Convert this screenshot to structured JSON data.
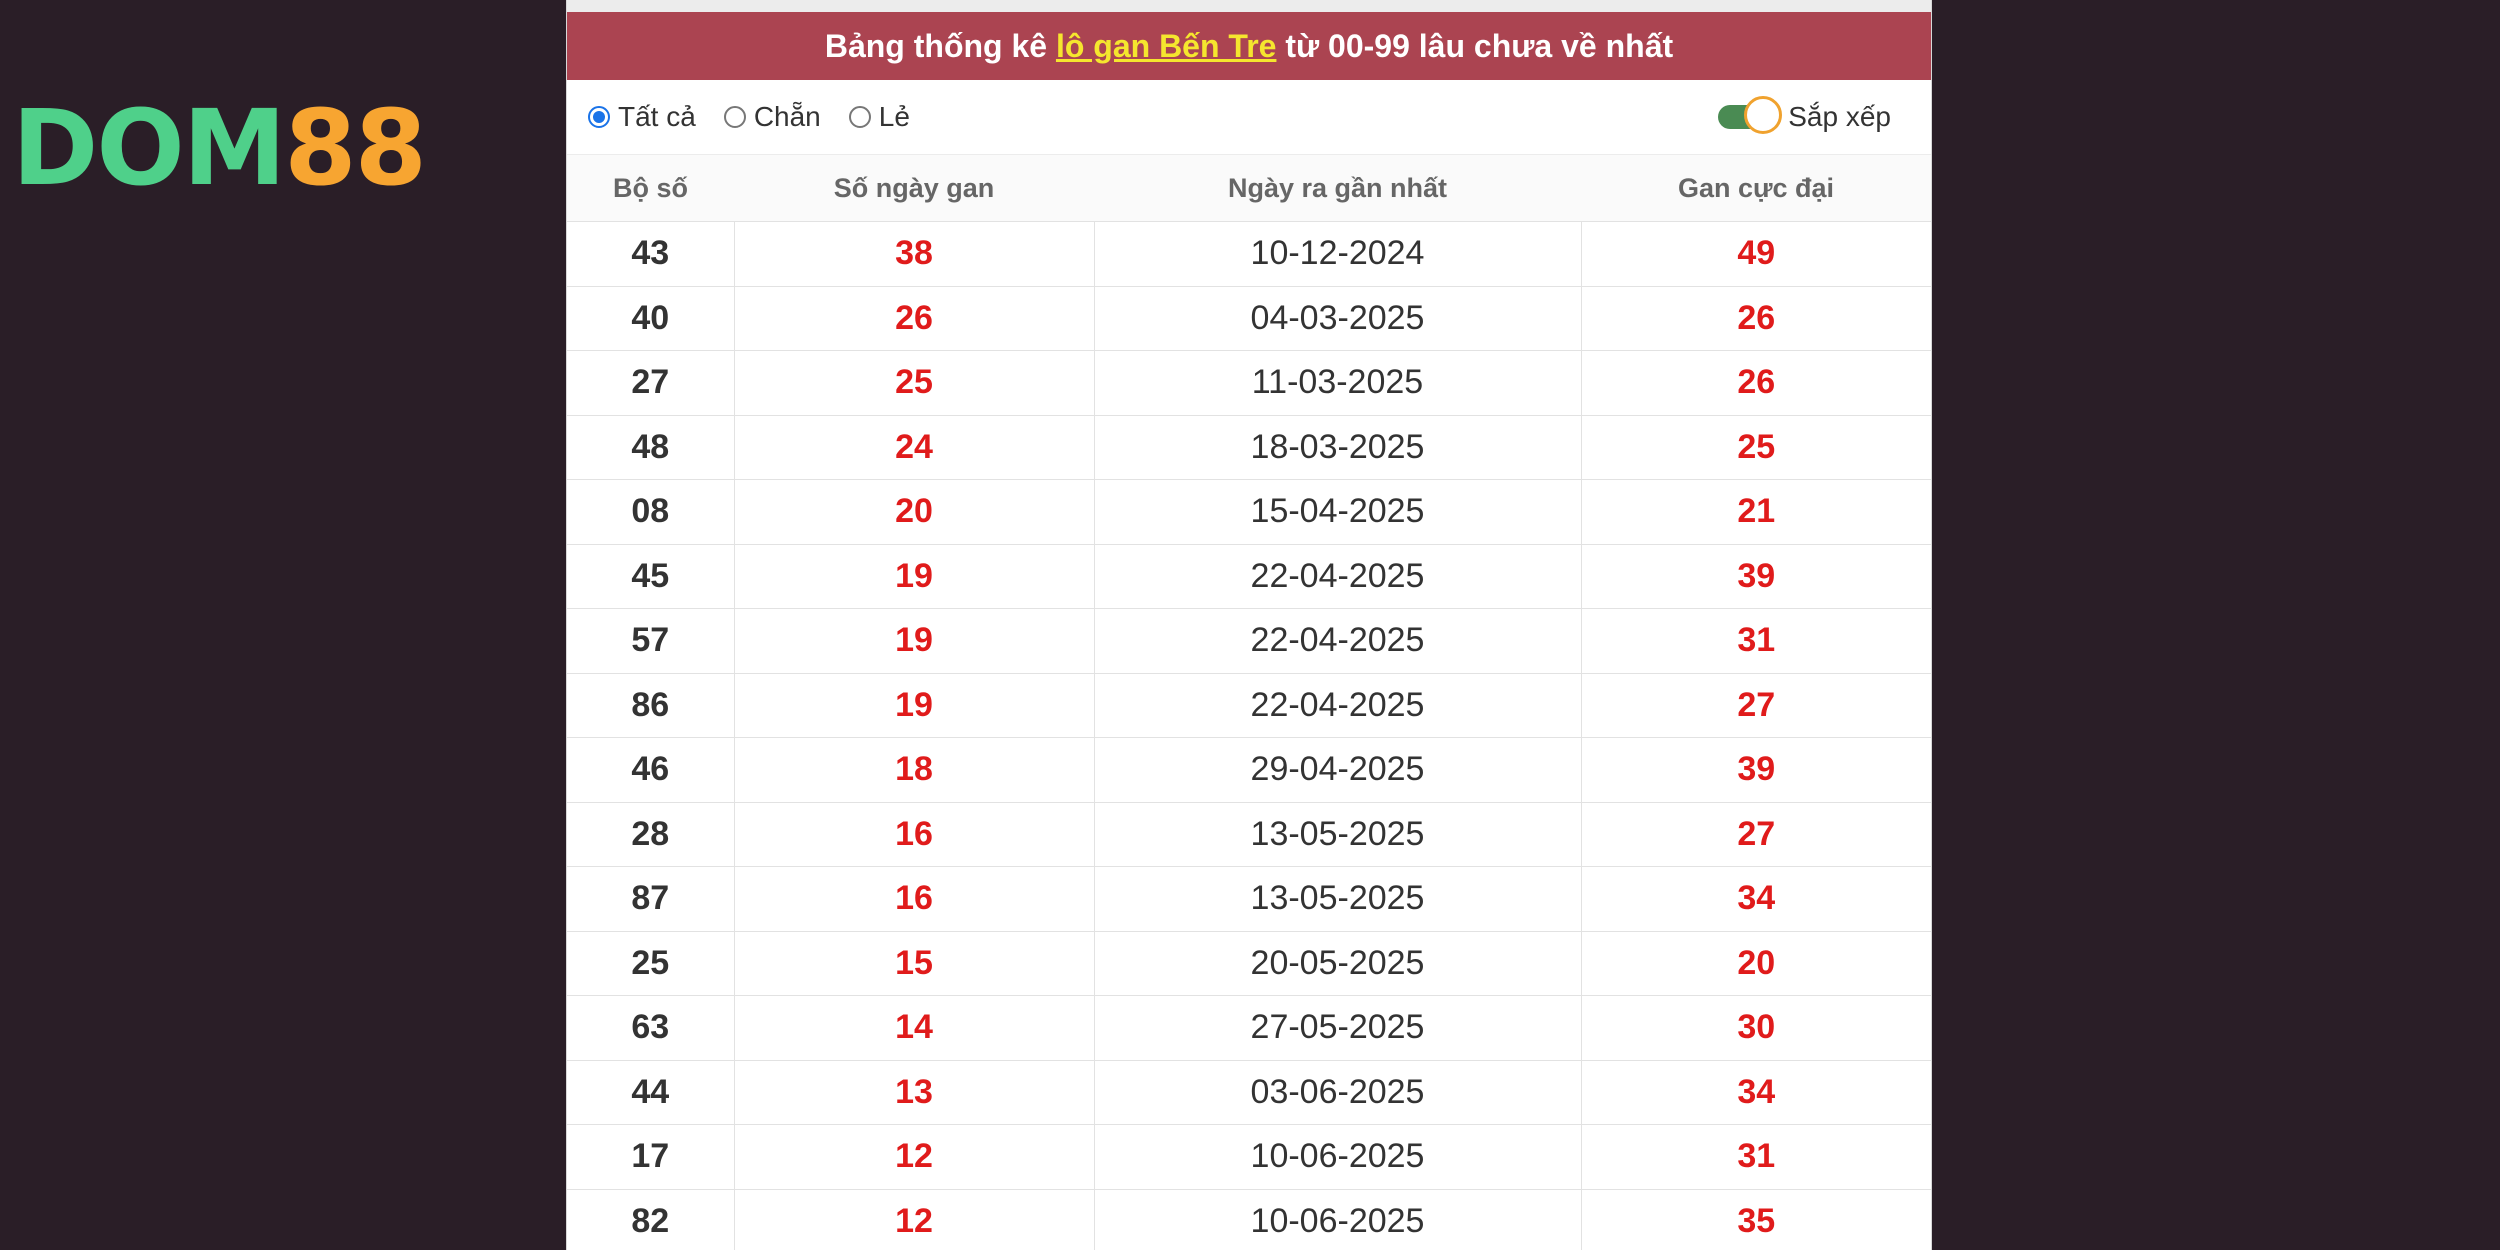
{
  "logo": {
    "text_main": "DOM",
    "text_accent": "88"
  },
  "title": {
    "prefix": "Bảng thống kê ",
    "link": "lô gan Bến Tre",
    "suffix": " từ 00-99 lâu chưa về nhất"
  },
  "filters": {
    "options": [
      {
        "label": "Tất cả",
        "checked": true
      },
      {
        "label": "Chẵn",
        "checked": false
      },
      {
        "label": "Lẻ",
        "checked": false
      }
    ],
    "sort_label": "Sắp xếp",
    "sort_on": true
  },
  "table": {
    "headers": [
      "Bộ số",
      "Số ngày gan",
      "Ngày ra gần nhất",
      "Gan cực đại"
    ],
    "rows": [
      [
        "43",
        "38",
        "10-12-2024",
        "49"
      ],
      [
        "40",
        "26",
        "04-03-2025",
        "26"
      ],
      [
        "27",
        "25",
        "11-03-2025",
        "26"
      ],
      [
        "48",
        "24",
        "18-03-2025",
        "25"
      ],
      [
        "08",
        "20",
        "15-04-2025",
        "21"
      ],
      [
        "45",
        "19",
        "22-04-2025",
        "39"
      ],
      [
        "57",
        "19",
        "22-04-2025",
        "31"
      ],
      [
        "86",
        "19",
        "22-04-2025",
        "27"
      ],
      [
        "46",
        "18",
        "29-04-2025",
        "39"
      ],
      [
        "28",
        "16",
        "13-05-2025",
        "27"
      ],
      [
        "87",
        "16",
        "13-05-2025",
        "34"
      ],
      [
        "25",
        "15",
        "20-05-2025",
        "20"
      ],
      [
        "63",
        "14",
        "27-05-2025",
        "30"
      ],
      [
        "44",
        "13",
        "03-06-2025",
        "34"
      ],
      [
        "17",
        "12",
        "10-06-2025",
        "31"
      ],
      [
        "82",
        "12",
        "10-06-2025",
        "35"
      ]
    ]
  },
  "colors": {
    "background": "#2a1e27",
    "title_bar": "#ab4451",
    "title_link": "#f5e62e",
    "highlight_value": "#e01b1b",
    "toggle_on": "#4a8b53",
    "toggle_knob_border": "#f0a22e",
    "logo_green": "#4fd08a",
    "logo_orange": "#f7a531"
  }
}
